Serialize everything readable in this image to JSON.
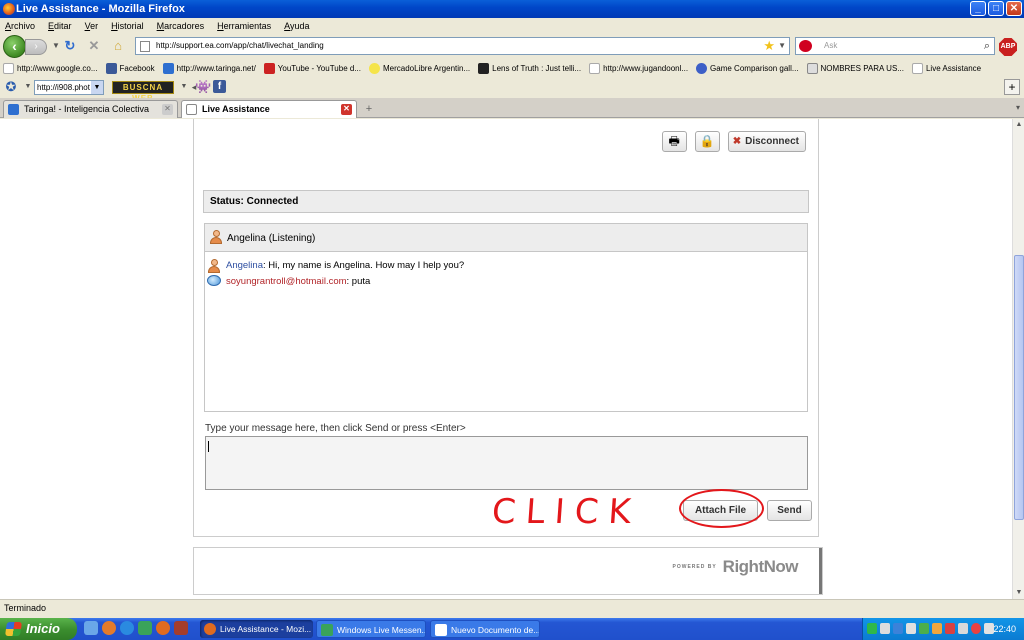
{
  "window": {
    "title": "Live Assistance - Mozilla Firefox",
    "controls": {
      "minimize": "_",
      "maximize": "□",
      "close": "✕"
    }
  },
  "menu": [
    "Archivo",
    "Editar",
    "Ver",
    "Historial",
    "Marcadores",
    "Herramientas",
    "Ayuda"
  ],
  "nav": {
    "url": "http://support.ea.com/app/chat/livechat_landing",
    "search_placeholder": "Ask",
    "adblock_label": "ABP"
  },
  "bookmarks": [
    {
      "label": "http://www.google.co...",
      "color": "#ffffff"
    },
    {
      "label": "Facebook",
      "color": "#3b5998"
    },
    {
      "label": "http://www.taringa.net/",
      "color": "#2e6fd0"
    },
    {
      "label": "YouTube - YouTube d...",
      "color": "#cc2222"
    },
    {
      "label": "MercadoLibre Argentin...",
      "color": "#f5e44a"
    },
    {
      "label": "Lens of Truth : Just telli...",
      "color": "#222222"
    },
    {
      "label": "http://www.jugandoonl...",
      "color": "#ffffff"
    },
    {
      "label": "Game Comparison gall...",
      "color": "#3d5fc7"
    },
    {
      "label": "NOMBRES PARA US...",
      "color": "#dddddd"
    },
    {
      "label": "Live Assistance",
      "color": "#ffffff"
    }
  ],
  "toolbar3": {
    "select_value": "http://i908.phot",
    "buscaweb_label": "BUSCNA WEB"
  },
  "tabs": [
    {
      "label": "Taringa! - Inteligencia Colectiva",
      "active": false
    },
    {
      "label": "Live Assistance",
      "active": true
    }
  ],
  "chat": {
    "disconnect_label": "Disconnect",
    "status": "Status: Connected",
    "agent_header": "Angelina (Listening)",
    "messages": [
      {
        "sender": "Angelina",
        "separator": ":",
        "text": " Hi, my name is Angelina. How may I help you?"
      },
      {
        "sender": "soyungrantroll@hotmail.com",
        "separator": ":",
        "text": " puta"
      }
    ],
    "input_prompt": "Type your message here, then click Send or press <Enter>",
    "attach_label": "Attach File",
    "send_label": "Send",
    "annotation": "CLICK"
  },
  "footer": {
    "powered_by": "POWERED BY",
    "brand": "RightNow"
  },
  "statusbar": "Terminado",
  "taskbar": {
    "start_label": "Inicio",
    "tasks": [
      "Live Assistance - Mozi...",
      "Windows Live Messen...",
      "Nuevo Documento de..."
    ],
    "clock": "22:40"
  }
}
